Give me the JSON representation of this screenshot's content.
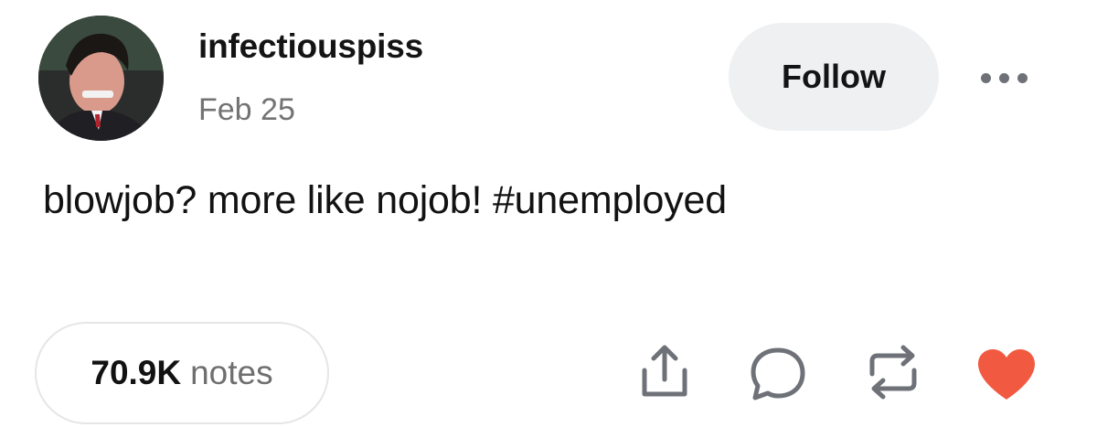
{
  "post": {
    "username": "infectiouspiss",
    "date": "Feb 25",
    "follow_label": "Follow",
    "text": "blowjob? more like nojob! #unemployed",
    "notes_count": "70.9K",
    "notes_label": "notes"
  },
  "icons": {
    "more": "more-options-icon",
    "share": "share-icon",
    "reply": "reply-icon",
    "reblog": "reblog-icon",
    "like": "heart-icon"
  },
  "colors": {
    "like_active": "#f15a40",
    "follow_bg": "#eff0f2",
    "secondary_text": "#737373",
    "icon_stroke": "#6e7278"
  }
}
